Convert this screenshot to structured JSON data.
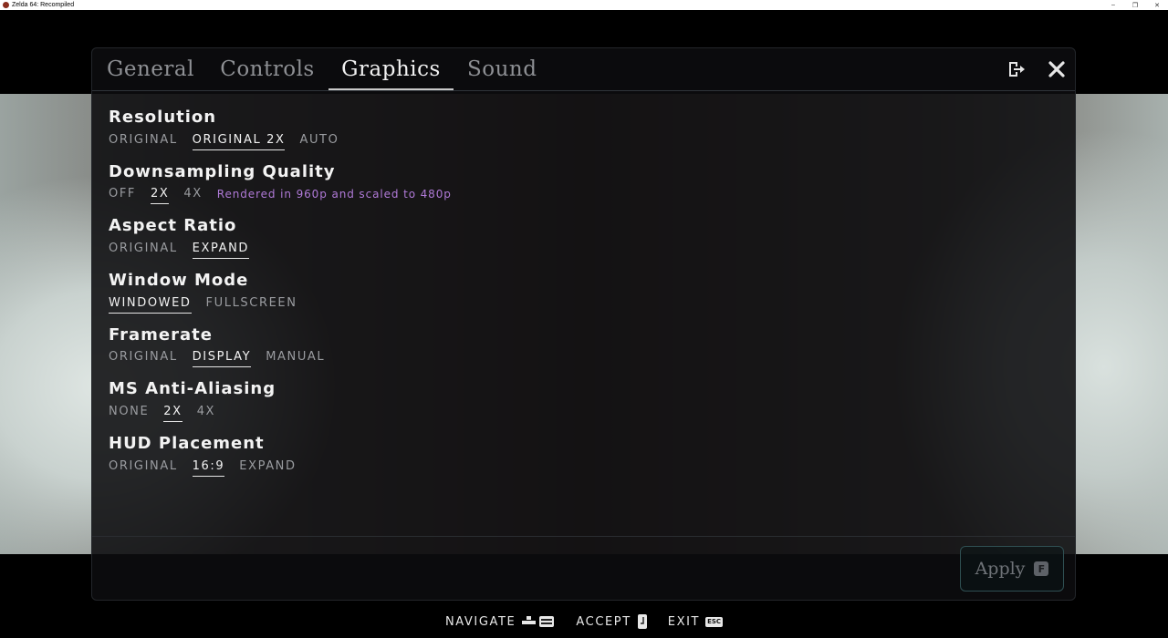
{
  "window": {
    "title": "Zelda 64: Recompiled",
    "controls": [
      "–",
      "❐",
      "✕"
    ]
  },
  "tabs": [
    {
      "label": "General",
      "active": false
    },
    {
      "label": "Controls",
      "active": false
    },
    {
      "label": "Graphics",
      "active": true
    },
    {
      "label": "Sound",
      "active": false
    }
  ],
  "header_icons": [
    "exit-to-menu-icon",
    "close-icon"
  ],
  "settings": {
    "resolution": {
      "label": "Resolution",
      "options": [
        "ORIGINAL",
        "ORIGINAL 2X",
        "AUTO"
      ],
      "selected": "ORIGINAL 2X"
    },
    "downsampling": {
      "label": "Downsampling Quality",
      "options": [
        "OFF",
        "2X",
        "4X"
      ],
      "selected": "2X",
      "hint": "Rendered in 960p and scaled to 480p"
    },
    "aspect_ratio": {
      "label": "Aspect Ratio",
      "options": [
        "ORIGINAL",
        "EXPAND"
      ],
      "selected": "EXPAND"
    },
    "window_mode": {
      "label": "Window Mode",
      "options": [
        "WINDOWED",
        "FULLSCREEN"
      ],
      "selected": "WINDOWED"
    },
    "framerate": {
      "label": "Framerate",
      "options": [
        "ORIGINAL",
        "DISPLAY",
        "MANUAL"
      ],
      "selected": "DISPLAY"
    },
    "msaa": {
      "label": "MS Anti-Aliasing",
      "options": [
        "NONE",
        "2X",
        "4X"
      ],
      "selected": "2X"
    },
    "hud_placement": {
      "label": "HUD Placement",
      "options": [
        "ORIGINAL",
        "16:9",
        "EXPAND"
      ],
      "selected": "16:9"
    }
  },
  "apply": {
    "label": "Apply",
    "key": "F"
  },
  "prompts": {
    "navigate": {
      "label": "NAVIGATE",
      "keys": [
        "dpad",
        "arrows"
      ]
    },
    "accept": {
      "label": "ACCEPT",
      "keys": [
        "enter"
      ]
    },
    "exit": {
      "label": "EXIT",
      "keys": [
        "ESC"
      ]
    }
  },
  "colors": {
    "selected": "#f2f2f2",
    "unselected": "#9a9ca0",
    "hint": "#b07ad8",
    "apply_border": "#2f4f52"
  }
}
